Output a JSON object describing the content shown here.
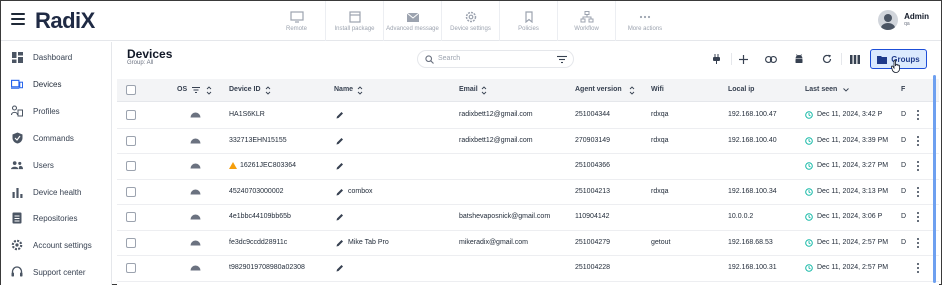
{
  "app": {
    "logo": "RadiX",
    "user": {
      "name": "Admin",
      "role": "qa"
    }
  },
  "top_actions": [
    {
      "label": "Remote",
      "icon": "monitor-icon"
    },
    {
      "label": "Install package",
      "icon": "package-icon"
    },
    {
      "label": "Advanced message",
      "icon": "mail-icon"
    },
    {
      "label": "Device settings",
      "icon": "gear-icon"
    },
    {
      "label": "Policies",
      "icon": "bookmark-icon"
    },
    {
      "label": "Workflow",
      "icon": "workflow-icon"
    },
    {
      "label": "More actions",
      "icon": "more-icon"
    }
  ],
  "sidebar": {
    "items": [
      {
        "label": "Dashboard",
        "icon": "dashboard-icon"
      },
      {
        "label": "Devices",
        "icon": "devices-icon"
      },
      {
        "label": "Profiles",
        "icon": "profiles-icon"
      },
      {
        "label": "Commands",
        "icon": "commands-icon"
      },
      {
        "label": "Users",
        "icon": "users-icon"
      },
      {
        "label": "Device health",
        "icon": "health-icon"
      },
      {
        "label": "Repositories",
        "icon": "repositories-icon"
      },
      {
        "label": "Account settings",
        "icon": "settings-icon"
      },
      {
        "label": "Support center",
        "icon": "headset-icon"
      }
    ],
    "active": "Devices"
  },
  "page": {
    "title": "Devices",
    "subtitle": "Group: All",
    "search_placeholder": "Search",
    "groups_button": "Groups"
  },
  "table": {
    "columns": [
      "OS",
      "Device ID",
      "Name",
      "Email",
      "Agent version",
      "Wifi",
      "Local ip",
      "Last seen",
      "F"
    ],
    "rows": [
      {
        "device_id": "HA1S6KLR",
        "name": "",
        "email": "radixbett12@gmail.com",
        "agent": "251004344",
        "wifi": "rdxqa",
        "ip": "192.168.100.47",
        "last_seen": "Dec 11, 2024, 3:42 P",
        "f": "D",
        "warning": false
      },
      {
        "device_id": "332713EHN15155",
        "name": "",
        "email": "radixbett12@gmail.com",
        "agent": "270903149",
        "wifi": "rdxqa",
        "ip": "192.168.100.40",
        "last_seen": "Dec 11, 2024, 3:39 PM",
        "f": "D",
        "warning": false
      },
      {
        "device_id": "16261JEC803364",
        "name": "",
        "email": "",
        "agent": "251004366",
        "wifi": "",
        "ip": "",
        "last_seen": "Dec 11, 2024, 3:27 PM",
        "f": "D",
        "warning": true
      },
      {
        "device_id": "45240703000002",
        "name": "combox",
        "email": "",
        "agent": "251004213",
        "wifi": "rdxqa",
        "ip": "192.168.100.34",
        "last_seen": "Dec 11, 2024, 3:13 PM",
        "f": "D",
        "warning": false
      },
      {
        "device_id": "4e1bbc44109bb65b",
        "name": "",
        "email": "batshevaposnick@gmail.com",
        "agent": "110904142",
        "wifi": "",
        "ip": "10.0.0.2",
        "last_seen": "Dec 11, 2024, 3:06 P",
        "f": "D",
        "warning": false
      },
      {
        "device_id": "fe3dc9ccdd28911c",
        "name": "Mike Tab Pro",
        "email": "mikeradix@gmail.com",
        "agent": "251004279",
        "wifi": "getout",
        "ip": "192.168.68.53",
        "last_seen": "Dec 11, 2024, 2:57 PM",
        "f": "D",
        "warning": false
      },
      {
        "device_id": "t9829019708980a02308",
        "name": "",
        "email": "",
        "agent": "251004228",
        "wifi": "",
        "ip": "192.168.100.31",
        "last_seen": "Dec 11, 2024, 2:57 PM",
        "f": "",
        "warning": false
      }
    ]
  },
  "colors": {
    "accent": "#1d4ed8",
    "accent_bg": "#dbeafe",
    "warning": "#f59e0b",
    "clock": "#14b8a6"
  }
}
